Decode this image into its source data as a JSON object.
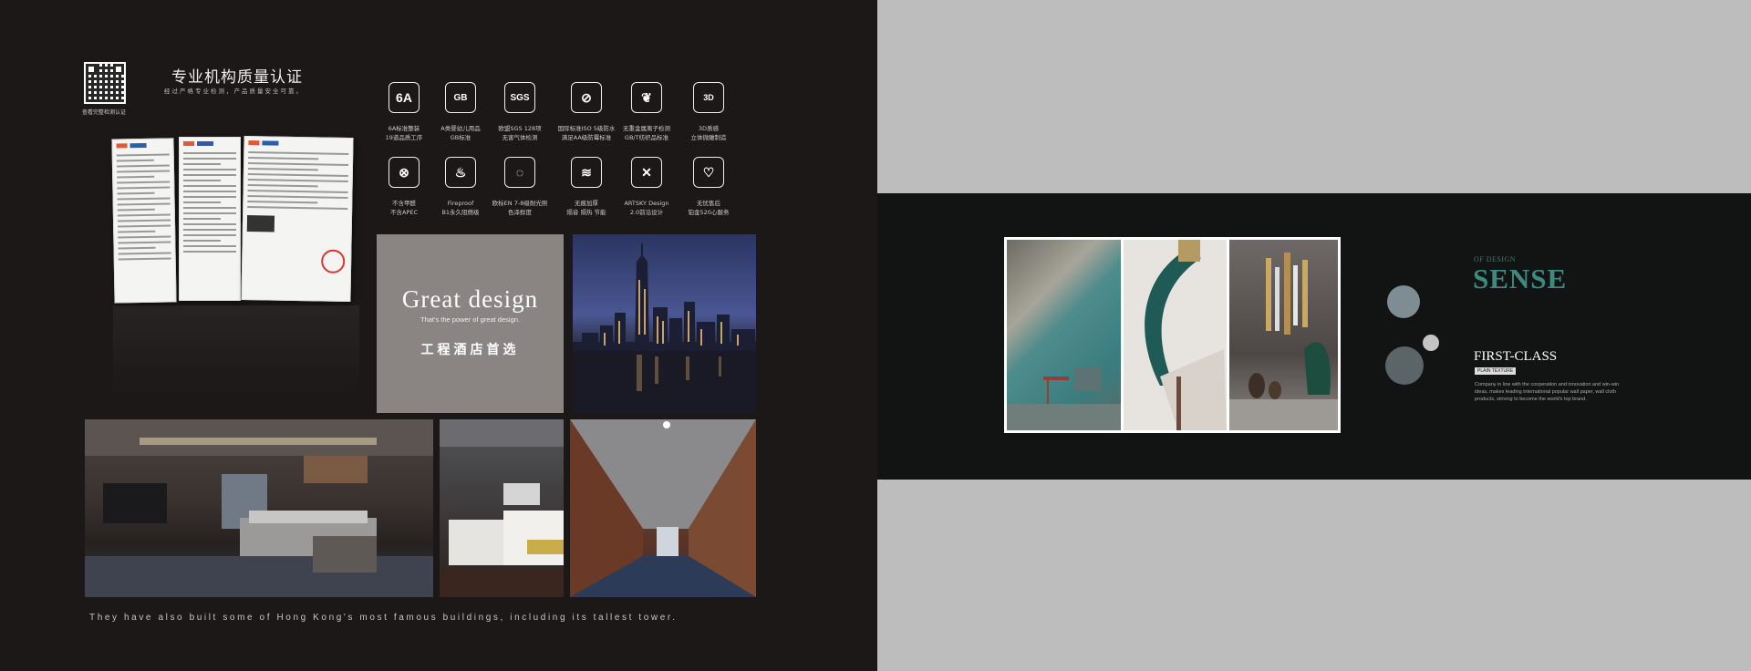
{
  "left_panel": {
    "qr_caption": "查看完整检测认证",
    "cert_title": "专业机构质量认证",
    "cert_subtitle": "经过严格专业检测，产品质量安全可靠。",
    "icons": [
      {
        "name": "6a-icon",
        "symbol": "6A",
        "line1": "6A标准整装",
        "line2": "19道品质工序"
      },
      {
        "name": "gb-icon",
        "symbol": "GB",
        "line1": "A类婴幼儿用品",
        "line2": "GB标准"
      },
      {
        "name": "sgs-icon",
        "symbol": "SGS",
        "line1": "欧盟SGS 128项",
        "line2": "无害气体检测"
      },
      {
        "name": "no-flame-icon",
        "symbol": "⊘",
        "line1": "国际标准ISO 5级防水",
        "line2": "满足AA级防霉标准"
      },
      {
        "name": "leaf-icon",
        "symbol": "❦",
        "line1": "无重金属离子检测",
        "line2": "GB/T纺织品标准"
      },
      {
        "name": "3d-icon",
        "symbol": "3D",
        "line1": "3D质感",
        "line2": "立体微雕制造"
      },
      {
        "name": "no-smoke-icon",
        "symbol": "⊗",
        "line1": "不含甲醛",
        "line2": "不含APEC"
      },
      {
        "name": "fireproof-icon",
        "symbol": "♨",
        "line1": "Fireproof",
        "line2": "B1永久阻燃级"
      },
      {
        "name": "sun-icon",
        "symbol": "◌",
        "line1": "欧标EN 7-8级耐光照",
        "line2": "色泽鲜度"
      },
      {
        "name": "heat-icon",
        "symbol": "≋",
        "line1": "无痕加厚",
        "line2": "隔音 隔热 节能"
      },
      {
        "name": "design-tools-icon",
        "symbol": "✕",
        "line1": "ARTSKY Design",
        "line2": "2.0前沿设计"
      },
      {
        "name": "heart-service-icon",
        "symbol": "♡",
        "line1": "无忧售后",
        "line2": "铂金520心服务"
      }
    ],
    "great_design": {
      "heading": "Great design",
      "sub": "That's the power of great design.",
      "chinese": "工程酒店首选"
    },
    "tagline": "They have also built some of Hong Kong's most famous buildings, including its tallest tower."
  },
  "right_panel": {
    "of_design": "OF DESIGN",
    "sense": "SENSE",
    "first_class": "FIRST-CLASS",
    "badge": "PLAIN TEXTURE",
    "description": "Company in line with the cooperation and innovation and win-win ideas, makes leading international popular wall paper, wall cloth products, striving to become the world's top brand."
  },
  "colors": {
    "left_bg": "#1b1817",
    "right_bg": "#bdbdbd",
    "band_bg": "#111413",
    "accent_teal": "#3f8a80"
  }
}
